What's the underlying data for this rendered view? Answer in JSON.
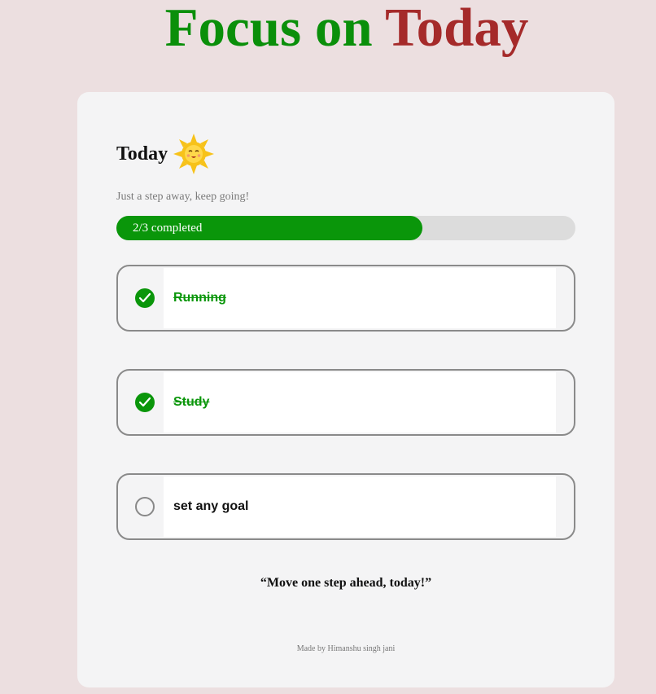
{
  "header": {
    "title_word_1": "Focus on",
    "title_word_2": "Today",
    "title_colors": [
      "#0a8f0a",
      "#a52a2a"
    ]
  },
  "card": {
    "heading": "Today",
    "heading_icon": "smiling-sun-icon",
    "subtitle": "Just a step away, keep going!",
    "progress": {
      "label": "2/3 completed",
      "completed": 2,
      "total": 3,
      "fill_color": "#0a960a"
    },
    "goals": [
      {
        "label": "Running",
        "done": true
      },
      {
        "label": "Study",
        "done": true
      },
      {
        "label": "set any goal",
        "done": false
      }
    ],
    "check_icon": "check-circle-icon",
    "unchecked_icon": "empty-circle-icon",
    "quote": "“Move one step ahead, today!”",
    "credit": "Made by Himanshu singh jani"
  }
}
